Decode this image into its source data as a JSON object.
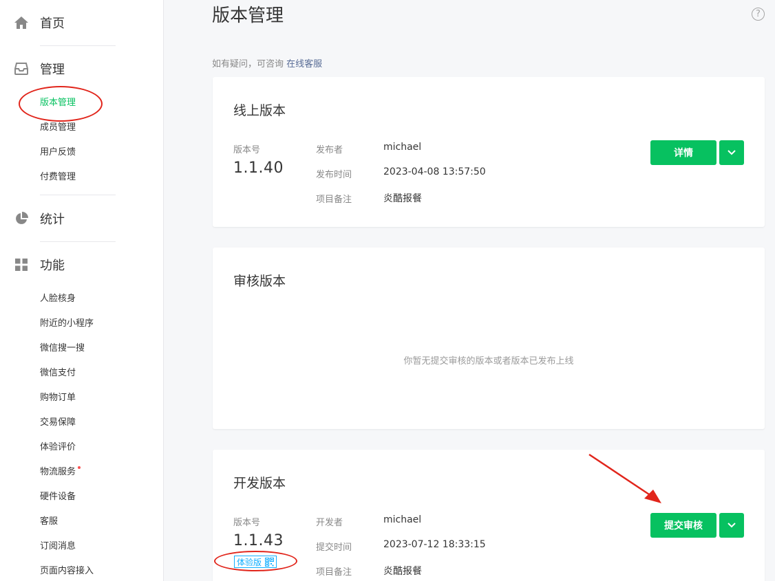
{
  "sidebar": {
    "home": {
      "label": "首页",
      "icon": "home-icon"
    },
    "manage": {
      "label": "管理",
      "icon": "inbox-icon",
      "items": [
        "版本管理",
        "成员管理",
        "用户反馈",
        "付费管理"
      ]
    },
    "stats": {
      "label": "统计",
      "icon": "pie-chart-icon"
    },
    "features": {
      "label": "功能",
      "icon": "grid-icon",
      "items": [
        "人脸核身",
        "附近的小程序",
        "微信搜一搜",
        "微信支付",
        "购物订单",
        "交易保障",
        "体验评价",
        "物流服务",
        "硬件设备",
        "客服",
        "订阅消息",
        "页面内容接入"
      ]
    }
  },
  "main": {
    "title": "版本管理",
    "hint_prefix": "如有疑问，可咨询",
    "hint_link": "在线客服",
    "online": {
      "title": "线上版本",
      "version_label": "版本号",
      "version": "1.1.40",
      "publisher_label": "发布者",
      "publisher": "michael",
      "time_label": "发布时间",
      "time": "2023-04-08 13:57:50",
      "note_label": "项目备注",
      "note": "炎酷报餐",
      "detail_button": "详情"
    },
    "review": {
      "title": "审核版本",
      "empty": "你暂无提交审核的版本或者版本已发布上线"
    },
    "dev": {
      "title": "开发版本",
      "version_label": "版本号",
      "version": "1.1.43",
      "trial_tag": "体验版",
      "developer_label": "开发者",
      "developer": "michael",
      "time_label": "提交时间",
      "time": "2023-07-12 18:33:15",
      "note_label": "项目备注",
      "note": "炎酷报餐",
      "submit_button": "提交审核"
    }
  },
  "colors": {
    "accent": "#07c160",
    "link": "#576b95",
    "annotation": "#e1251b",
    "tag": "#10aeff"
  }
}
